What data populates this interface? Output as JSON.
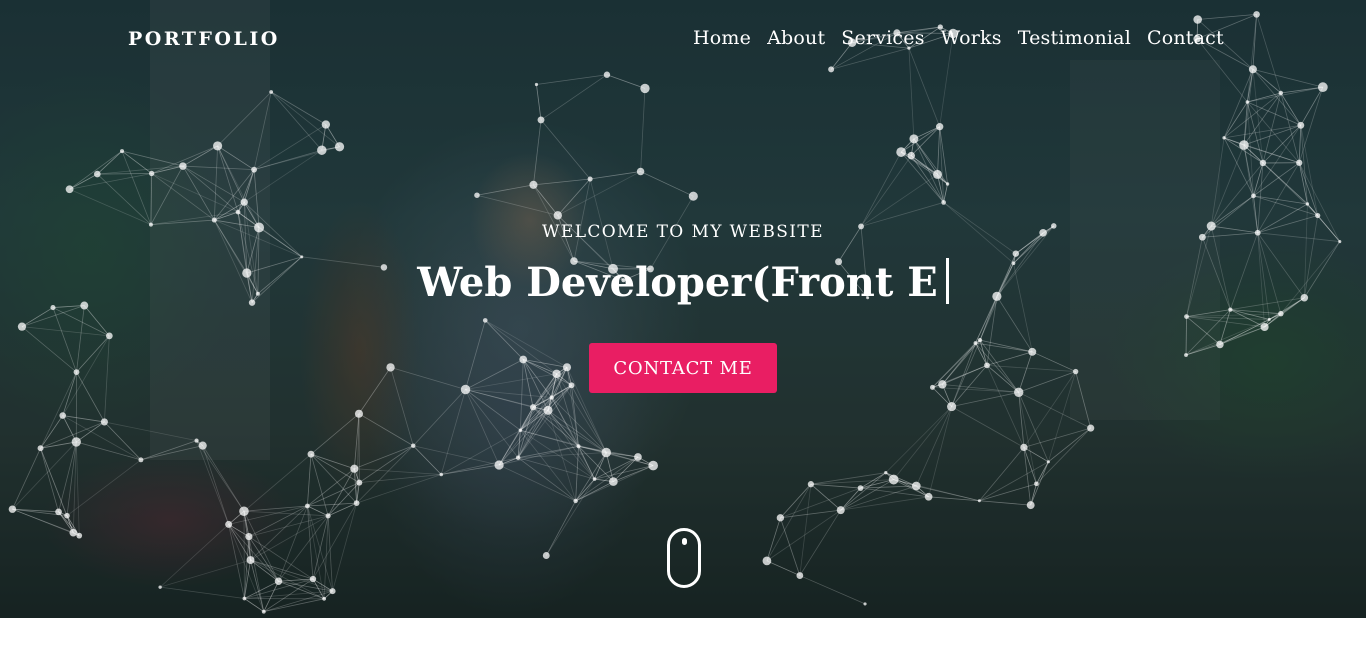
{
  "nav": {
    "logo": "PORTFOLIO",
    "items": [
      "Home",
      "About",
      "Services",
      "Works",
      "Testimonial",
      "Contact"
    ]
  },
  "hero": {
    "welcome": "WELCOME TO MY WEBSITE",
    "typed_text": "Web Developer(Front E",
    "contact_button": "CONTACT ME"
  },
  "icons": {
    "scroll": "mouse-scroll-icon",
    "network": "particle-network"
  },
  "colors": {
    "accent": "#e91e63",
    "text": "#ffffff",
    "overlay": "#223a3e"
  }
}
